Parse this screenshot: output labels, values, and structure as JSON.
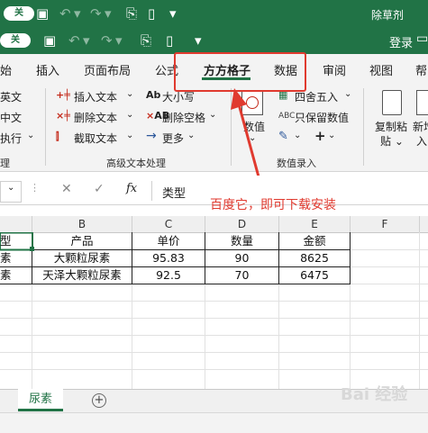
{
  "titlebar": {
    "user": "除草剂"
  },
  "toolbar2": {
    "sign_in": "登录"
  },
  "toggle_label": "关",
  "tabs": [
    "始",
    "插入",
    "页面布局",
    "公式",
    "方方格子",
    "数据",
    "审阅",
    "视图",
    "帮"
  ],
  "ribbon": {
    "left_items": [
      "英文",
      "中文",
      "执行"
    ],
    "left_group": "理",
    "text_group": {
      "col1": [
        "插入文本",
        "删除文本",
        "截取文本"
      ],
      "col2": [
        "大小写",
        "删除空格",
        "更多"
      ],
      "label": "高级文本处理"
    },
    "data_group": {
      "big_button": "数值",
      "items": [
        "四舍五入",
        "只保留数值"
      ],
      "label": "数值录入"
    },
    "copy_paste": "复制粘贴",
    "new_insert": "新增插入"
  },
  "formula_bar": {
    "fx": "fx",
    "content": "类型"
  },
  "annotation": {
    "text": "百度它，即可下载安装",
    "color": "#e03a2f"
  },
  "columns": [
    "B",
    "C",
    "D",
    "E",
    "F"
  ],
  "table": {
    "headers": [
      "型",
      "产品",
      "单价",
      "数量",
      "金额"
    ],
    "rows": [
      [
        "素",
        "大颗粒尿素",
        "95.83",
        "90",
        "8625"
      ],
      [
        "素",
        "天泽大颗粒尿素",
        "92.5",
        "70",
        "6475"
      ]
    ]
  },
  "sheet_tab": "尿素",
  "watermark": "Bai 经验"
}
